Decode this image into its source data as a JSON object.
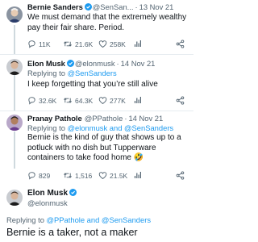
{
  "tweets": [
    {
      "name": "Bernie Sanders",
      "handle": "@SenSan...",
      "date": "13 Nov 21",
      "text": "We must demand that the extremely wealthy pay their fair share. Period.",
      "replies": "11K",
      "retweets": "21.6K",
      "likes": "258K"
    },
    {
      "name": "Elon Musk",
      "handle": "@elonmusk",
      "date": "14 Nov 21",
      "replying_to_prefix": "Replying to ",
      "replying_to": "@SenSanders",
      "text": "I keep forgetting that you’re still alive",
      "replies": "32.6K",
      "retweets": "64.3K",
      "likes": "277K"
    },
    {
      "name": "Pranay Pathole",
      "handle": "@PPathole",
      "date": "14 Nov 21",
      "replying_to_prefix": "Replying to ",
      "replying_to": "@elonmusk and @SenSanders",
      "text": "Bernie is the kind of guy that shows up to a potluck with no dish but Tupperware containers to take food home 🤣",
      "replies": "829",
      "retweets": "1,516",
      "likes": "21.5K"
    }
  ],
  "final_tweet": {
    "name": "Elon Musk",
    "handle": "@elonmusk",
    "replying_to_prefix": "Replying to ",
    "replying_to": "@PPathole and @SenSanders",
    "text": "Bernie is a taker, not a maker"
  },
  "separator": "·",
  "colors": {
    "accent": "#1d9bf0",
    "muted": "#536471",
    "text": "#0f1419"
  },
  "icons": [
    "verified-badge-icon",
    "reply-icon",
    "retweet-icon",
    "like-icon",
    "views-icon",
    "share-icon"
  ]
}
